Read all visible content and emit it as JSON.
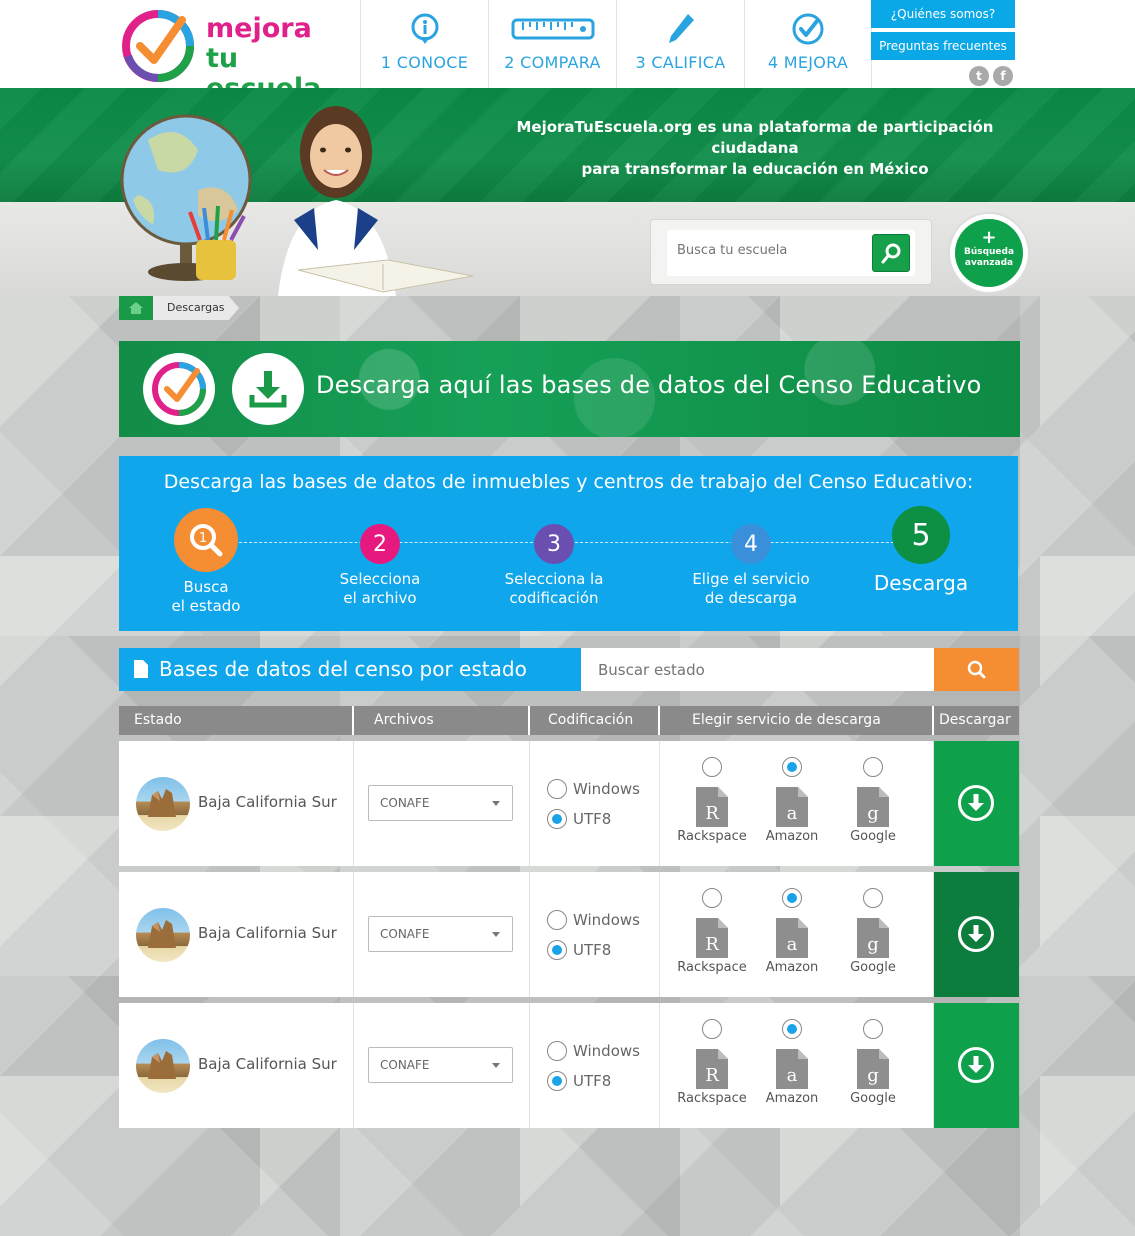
{
  "brand": {
    "line1": "mejora",
    "line2": "tu escuela",
    "colors": {
      "pink": "#e0218a",
      "green": "#1fa14a",
      "blue": "#2aa4e0",
      "orange": "#f58d33"
    }
  },
  "nav": [
    {
      "label": "1 CONOCE",
      "icon": "info-icon"
    },
    {
      "label": "2 COMPARA",
      "icon": "ruler-icon"
    },
    {
      "label": "3 CALIFICA",
      "icon": "pencil-icon"
    },
    {
      "label": "4 MEJORA",
      "icon": "check-circle-icon"
    }
  ],
  "top_links": {
    "about": "¿Quiénes somos?",
    "faq": "Preguntas frecuentes"
  },
  "social": {
    "twitter": "t",
    "facebook": "f"
  },
  "hero": {
    "tagline_line1": "MejoraTuEscuela.org es una plataforma de participación ciudadana",
    "tagline_line2": "para transformar la educación en México",
    "search_placeholder": "Busca tu escuela",
    "advanced_plus": "+",
    "advanced_line1": "Búsqueda",
    "advanced_line2": "avanzada"
  },
  "breadcrumb": {
    "current": "Descargas"
  },
  "banner": {
    "title": "Descarga aquí las bases de datos del Censo Educativo"
  },
  "steps": {
    "title": "Descarga las bases de datos de inmuebles y centros de trabajo del Censo Educativo:",
    "items": [
      {
        "number": "1",
        "line1": "Busca",
        "line2": "el estado",
        "color": "#f58d33"
      },
      {
        "number": "2",
        "line1": "Selecciona",
        "line2": "el archivo",
        "color": "#e6197f"
      },
      {
        "number": "3",
        "line1": "Selecciona la",
        "line2": "codificación",
        "color": "#6a4fb1"
      },
      {
        "number": "4",
        "line1": "Elige el servicio",
        "line2": "de descarga",
        "color": "#3a8fdb"
      },
      {
        "number": "5",
        "line1": "Descarga",
        "line2": "",
        "color": "#0d8f44"
      }
    ]
  },
  "table_section": {
    "title": "Bases de datos del censo por estado",
    "search_placeholder": "Buscar estado"
  },
  "table": {
    "headers": [
      "Estado",
      "Archivos",
      "Codificación",
      "Elegir servicio de descarga",
      "Descargar"
    ],
    "encoding_options": [
      "Windows",
      "UTF8"
    ],
    "services": [
      "Rackspace",
      "Amazon",
      "Google"
    ],
    "rows": [
      {
        "state": "Baja California Sur",
        "file": "CONAFE",
        "encoding": "UTF8",
        "service": "Amazon"
      },
      {
        "state": "Baja California Sur",
        "file": "CONAFE",
        "encoding": "UTF8",
        "service": "Amazon"
      },
      {
        "state": "Baja California Sur",
        "file": "CONAFE",
        "encoding": "UTF8",
        "service": "Amazon"
      }
    ]
  }
}
